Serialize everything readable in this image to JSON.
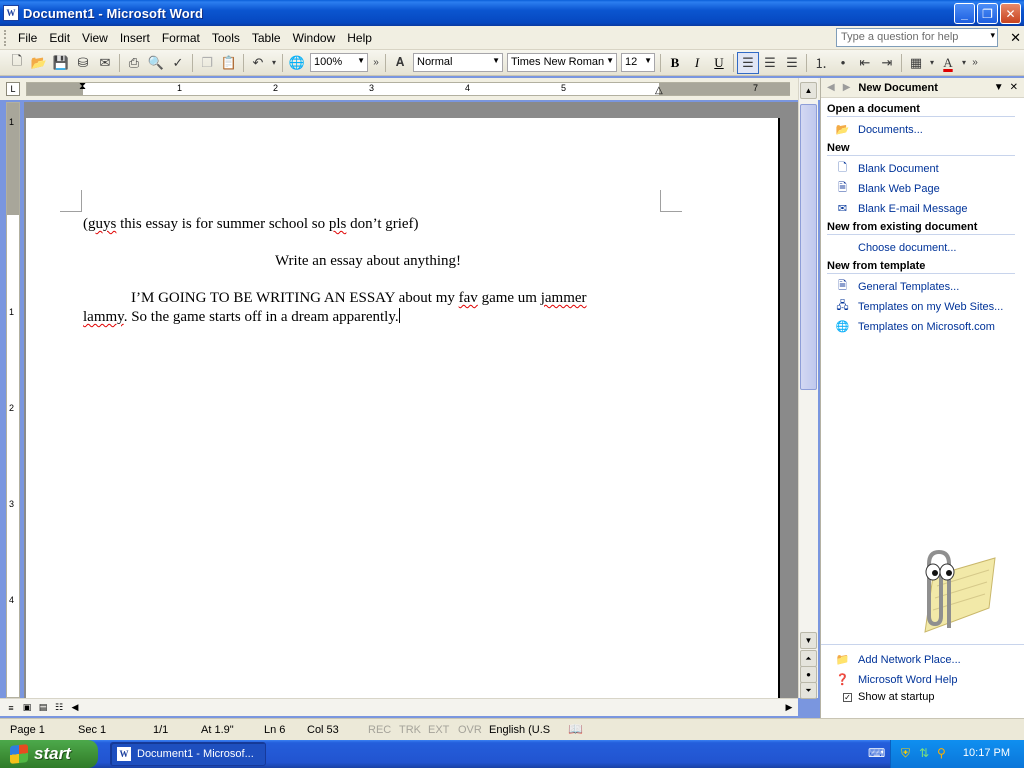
{
  "window": {
    "title": "Document1 - Microsoft Word",
    "icon": "word-doc-icon"
  },
  "menu": {
    "items": [
      {
        "label": "File"
      },
      {
        "label": "Edit"
      },
      {
        "label": "View"
      },
      {
        "label": "Insert"
      },
      {
        "label": "Format"
      },
      {
        "label": "Tools"
      },
      {
        "label": "Table"
      },
      {
        "label": "Window"
      },
      {
        "label": "Help"
      }
    ],
    "help_placeholder": "Type a question for help"
  },
  "toolbar": {
    "zoom": "100%",
    "style": "Normal",
    "font": "Times New Roman",
    "size": "12",
    "bold": "B",
    "italic": "I",
    "underline": "U",
    "font_color": "#e00000"
  },
  "ruler": {
    "labels": [
      "1",
      "2",
      "3",
      "4",
      "5",
      "7"
    ],
    "vlabels": [
      "1",
      "1",
      "2",
      "3",
      "4"
    ]
  },
  "document": {
    "line1_pre": "(",
    "line1_guys": "guys",
    "line1_mid": " this essay is for summer school so ",
    "line1_pls": "pls",
    "line1_post": " don’t grief)",
    "heading": "Write an essay about anything!",
    "para_line1_pre": "I’M GOING TO BE WRITING AN ESSAY about my ",
    "para_fav": "fav",
    "para_mid": " game um ",
    "para_jammer": "jammer",
    "para_line2_lammy": "lammy",
    "para_line2_rest": ". So the game starts off in a dream apparently."
  },
  "taskpane": {
    "title": "New Document",
    "sections": {
      "open": "Open a document",
      "new": "New",
      "existing": "New from existing document",
      "template": "New from template"
    },
    "links": {
      "documents": "Documents...",
      "blank_document": "Blank Document",
      "blank_web_page": "Blank Web Page",
      "blank_email": "Blank E-mail Message",
      "choose_document": "Choose document...",
      "general_templates": "General Templates...",
      "templates_web_sites": "Templates on my Web Sites...",
      "templates_microsoft": "Templates on Microsoft.com",
      "add_network_place": "Add Network Place...",
      "word_help": "Microsoft Word Help"
    },
    "show_at_startup": "Show at startup"
  },
  "status": {
    "page": "Page 1",
    "sec": "Sec 1",
    "pages": "1/1",
    "at": "At 1.9\"",
    "ln": "Ln 6",
    "col": "Col 53",
    "rec": "REC",
    "trk": "TRK",
    "ext": "EXT",
    "ovr": "OVR",
    "language": "English (U.S"
  },
  "taskbar": {
    "start": "start",
    "task": "Document1 - Microsof...",
    "clock": "10:17 PM"
  },
  "colors": {
    "link": "#003399",
    "title_bar": "#0b55d0",
    "taskbar": "#245edb",
    "start": "#3c8d35"
  }
}
